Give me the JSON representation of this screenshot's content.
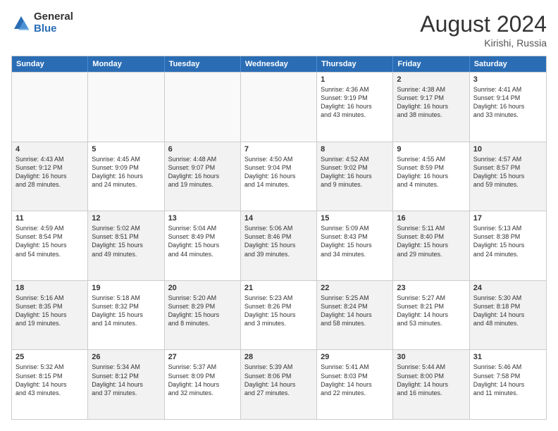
{
  "logo": {
    "general": "General",
    "blue": "Blue"
  },
  "title": "August 2024",
  "subtitle": "Kirishi, Russia",
  "days": [
    "Sunday",
    "Monday",
    "Tuesday",
    "Wednesday",
    "Thursday",
    "Friday",
    "Saturday"
  ],
  "weeks": [
    [
      {
        "day": "",
        "shade": "empty",
        "lines": []
      },
      {
        "day": "",
        "shade": "empty",
        "lines": []
      },
      {
        "day": "",
        "shade": "empty",
        "lines": []
      },
      {
        "day": "",
        "shade": "empty",
        "lines": []
      },
      {
        "day": "1",
        "shade": "",
        "lines": [
          "Sunrise: 4:36 AM",
          "Sunset: 9:19 PM",
          "Daylight: 16 hours",
          "and 43 minutes."
        ]
      },
      {
        "day": "2",
        "shade": "shaded",
        "lines": [
          "Sunrise: 4:38 AM",
          "Sunset: 9:17 PM",
          "Daylight: 16 hours",
          "and 38 minutes."
        ]
      },
      {
        "day": "3",
        "shade": "",
        "lines": [
          "Sunrise: 4:41 AM",
          "Sunset: 9:14 PM",
          "Daylight: 16 hours",
          "and 33 minutes."
        ]
      }
    ],
    [
      {
        "day": "4",
        "shade": "shaded",
        "lines": [
          "Sunrise: 4:43 AM",
          "Sunset: 9:12 PM",
          "Daylight: 16 hours",
          "and 28 minutes."
        ]
      },
      {
        "day": "5",
        "shade": "",
        "lines": [
          "Sunrise: 4:45 AM",
          "Sunset: 9:09 PM",
          "Daylight: 16 hours",
          "and 24 minutes."
        ]
      },
      {
        "day": "6",
        "shade": "shaded",
        "lines": [
          "Sunrise: 4:48 AM",
          "Sunset: 9:07 PM",
          "Daylight: 16 hours",
          "and 19 minutes."
        ]
      },
      {
        "day": "7",
        "shade": "",
        "lines": [
          "Sunrise: 4:50 AM",
          "Sunset: 9:04 PM",
          "Daylight: 16 hours",
          "and 14 minutes."
        ]
      },
      {
        "day": "8",
        "shade": "shaded",
        "lines": [
          "Sunrise: 4:52 AM",
          "Sunset: 9:02 PM",
          "Daylight: 16 hours",
          "and 9 minutes."
        ]
      },
      {
        "day": "9",
        "shade": "",
        "lines": [
          "Sunrise: 4:55 AM",
          "Sunset: 8:59 PM",
          "Daylight: 16 hours",
          "and 4 minutes."
        ]
      },
      {
        "day": "10",
        "shade": "shaded",
        "lines": [
          "Sunrise: 4:57 AM",
          "Sunset: 8:57 PM",
          "Daylight: 15 hours",
          "and 59 minutes."
        ]
      }
    ],
    [
      {
        "day": "11",
        "shade": "",
        "lines": [
          "Sunrise: 4:59 AM",
          "Sunset: 8:54 PM",
          "Daylight: 15 hours",
          "and 54 minutes."
        ]
      },
      {
        "day": "12",
        "shade": "shaded",
        "lines": [
          "Sunrise: 5:02 AM",
          "Sunset: 8:51 PM",
          "Daylight: 15 hours",
          "and 49 minutes."
        ]
      },
      {
        "day": "13",
        "shade": "",
        "lines": [
          "Sunrise: 5:04 AM",
          "Sunset: 8:49 PM",
          "Daylight: 15 hours",
          "and 44 minutes."
        ]
      },
      {
        "day": "14",
        "shade": "shaded",
        "lines": [
          "Sunrise: 5:06 AM",
          "Sunset: 8:46 PM",
          "Daylight: 15 hours",
          "and 39 minutes."
        ]
      },
      {
        "day": "15",
        "shade": "",
        "lines": [
          "Sunrise: 5:09 AM",
          "Sunset: 8:43 PM",
          "Daylight: 15 hours",
          "and 34 minutes."
        ]
      },
      {
        "day": "16",
        "shade": "shaded",
        "lines": [
          "Sunrise: 5:11 AM",
          "Sunset: 8:40 PM",
          "Daylight: 15 hours",
          "and 29 minutes."
        ]
      },
      {
        "day": "17",
        "shade": "",
        "lines": [
          "Sunrise: 5:13 AM",
          "Sunset: 8:38 PM",
          "Daylight: 15 hours",
          "and 24 minutes."
        ]
      }
    ],
    [
      {
        "day": "18",
        "shade": "shaded",
        "lines": [
          "Sunrise: 5:16 AM",
          "Sunset: 8:35 PM",
          "Daylight: 15 hours",
          "and 19 minutes."
        ]
      },
      {
        "day": "19",
        "shade": "",
        "lines": [
          "Sunrise: 5:18 AM",
          "Sunset: 8:32 PM",
          "Daylight: 15 hours",
          "and 14 minutes."
        ]
      },
      {
        "day": "20",
        "shade": "shaded",
        "lines": [
          "Sunrise: 5:20 AM",
          "Sunset: 8:29 PM",
          "Daylight: 15 hours",
          "and 8 minutes."
        ]
      },
      {
        "day": "21",
        "shade": "",
        "lines": [
          "Sunrise: 5:23 AM",
          "Sunset: 8:26 PM",
          "Daylight: 15 hours",
          "and 3 minutes."
        ]
      },
      {
        "day": "22",
        "shade": "shaded",
        "lines": [
          "Sunrise: 5:25 AM",
          "Sunset: 8:24 PM",
          "Daylight: 14 hours",
          "and 58 minutes."
        ]
      },
      {
        "day": "23",
        "shade": "",
        "lines": [
          "Sunrise: 5:27 AM",
          "Sunset: 8:21 PM",
          "Daylight: 14 hours",
          "and 53 minutes."
        ]
      },
      {
        "day": "24",
        "shade": "shaded",
        "lines": [
          "Sunrise: 5:30 AM",
          "Sunset: 8:18 PM",
          "Daylight: 14 hours",
          "and 48 minutes."
        ]
      }
    ],
    [
      {
        "day": "25",
        "shade": "",
        "lines": [
          "Sunrise: 5:32 AM",
          "Sunset: 8:15 PM",
          "Daylight: 14 hours",
          "and 43 minutes."
        ]
      },
      {
        "day": "26",
        "shade": "shaded",
        "lines": [
          "Sunrise: 5:34 AM",
          "Sunset: 8:12 PM",
          "Daylight: 14 hours",
          "and 37 minutes."
        ]
      },
      {
        "day": "27",
        "shade": "",
        "lines": [
          "Sunrise: 5:37 AM",
          "Sunset: 8:09 PM",
          "Daylight: 14 hours",
          "and 32 minutes."
        ]
      },
      {
        "day": "28",
        "shade": "shaded",
        "lines": [
          "Sunrise: 5:39 AM",
          "Sunset: 8:06 PM",
          "Daylight: 14 hours",
          "and 27 minutes."
        ]
      },
      {
        "day": "29",
        "shade": "",
        "lines": [
          "Sunrise: 5:41 AM",
          "Sunset: 8:03 PM",
          "Daylight: 14 hours",
          "and 22 minutes."
        ]
      },
      {
        "day": "30",
        "shade": "shaded",
        "lines": [
          "Sunrise: 5:44 AM",
          "Sunset: 8:00 PM",
          "Daylight: 14 hours",
          "and 16 minutes."
        ]
      },
      {
        "day": "31",
        "shade": "",
        "lines": [
          "Sunrise: 5:46 AM",
          "Sunset: 7:58 PM",
          "Daylight: 14 hours",
          "and 11 minutes."
        ]
      }
    ]
  ]
}
